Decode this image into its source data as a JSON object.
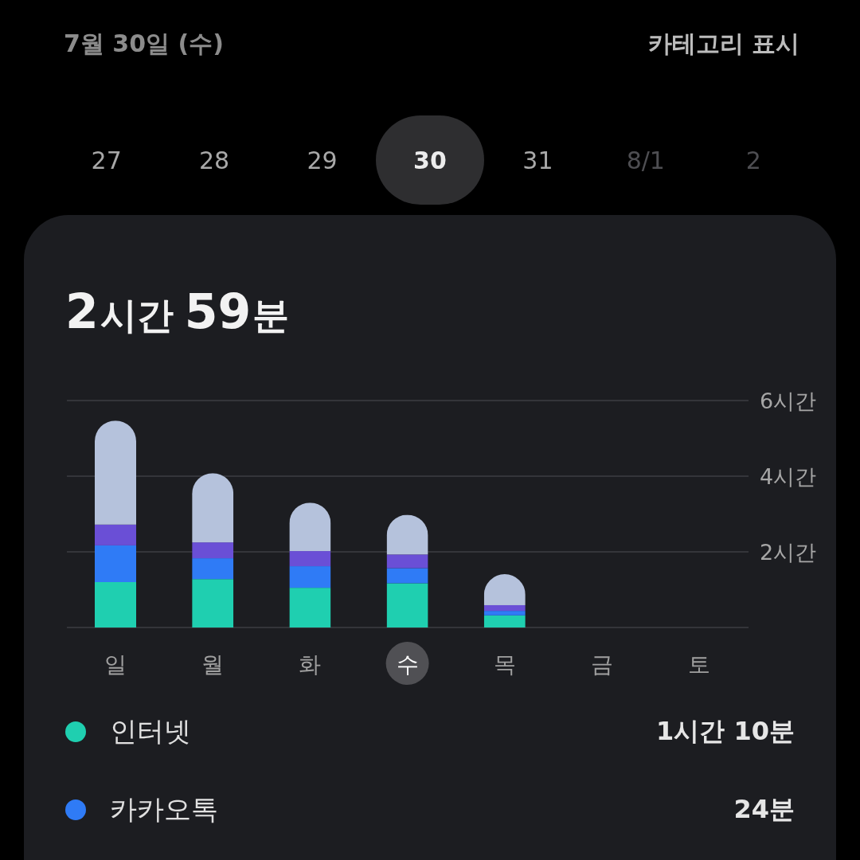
{
  "header": {
    "date_title": "7월 30일 (수)",
    "category_toggle": "카테고리 표시"
  },
  "dates": [
    {
      "label": "27",
      "selected": false,
      "disabled": false
    },
    {
      "label": "28",
      "selected": false,
      "disabled": false
    },
    {
      "label": "29",
      "selected": false,
      "disabled": false
    },
    {
      "label": "30",
      "selected": true,
      "disabled": false
    },
    {
      "label": "31",
      "selected": false,
      "disabled": false
    },
    {
      "label": "8/1",
      "selected": false,
      "disabled": true
    },
    {
      "label": "2",
      "selected": false,
      "disabled": true
    }
  ],
  "summary": {
    "total": [
      {
        "number": "2",
        "unit": "시간"
      },
      {
        "number": "59",
        "unit": "분"
      }
    ]
  },
  "chart": {
    "days": [
      {
        "selected": false
      },
      {
        "selected": false
      },
      {
        "selected": false
      },
      {
        "selected": true
      },
      {
        "selected": false
      },
      {
        "selected": false
      },
      {
        "selected": false
      }
    ],
    "chart_data": {
      "type": "bar",
      "stacked": true,
      "categories": [
        "일",
        "월",
        "화",
        "수",
        "목",
        "금",
        "토"
      ],
      "ylim": [
        0,
        6
      ],
      "yticks": [
        {
          "value": 2,
          "label": "2시간"
        },
        {
          "value": 4,
          "label": "4시간"
        },
        {
          "value": 6,
          "label": "6시간"
        }
      ],
      "series": [
        {
          "color": "#1fcfb0",
          "values": [
            1.2,
            1.28,
            1.05,
            1.17,
            0.32,
            null,
            null
          ]
        },
        {
          "color": "#2f7bf6",
          "values": [
            0.97,
            0.55,
            0.57,
            0.4,
            0.12,
            null,
            null
          ]
        },
        {
          "color": "#6a4fd6",
          "values": [
            0.55,
            0.42,
            0.4,
            0.36,
            0.15,
            null,
            null
          ]
        },
        {
          "color": "#b5c2dc",
          "values": [
            2.75,
            1.83,
            1.28,
            1.05,
            0.82,
            null,
            null
          ]
        }
      ]
    }
  },
  "legend": [
    {
      "name": "인터넷",
      "time": "1시간 10분",
      "color": "#1fcfb0"
    },
    {
      "name": "카카오톡",
      "time": "24분",
      "color": "#2f7bf6"
    }
  ]
}
